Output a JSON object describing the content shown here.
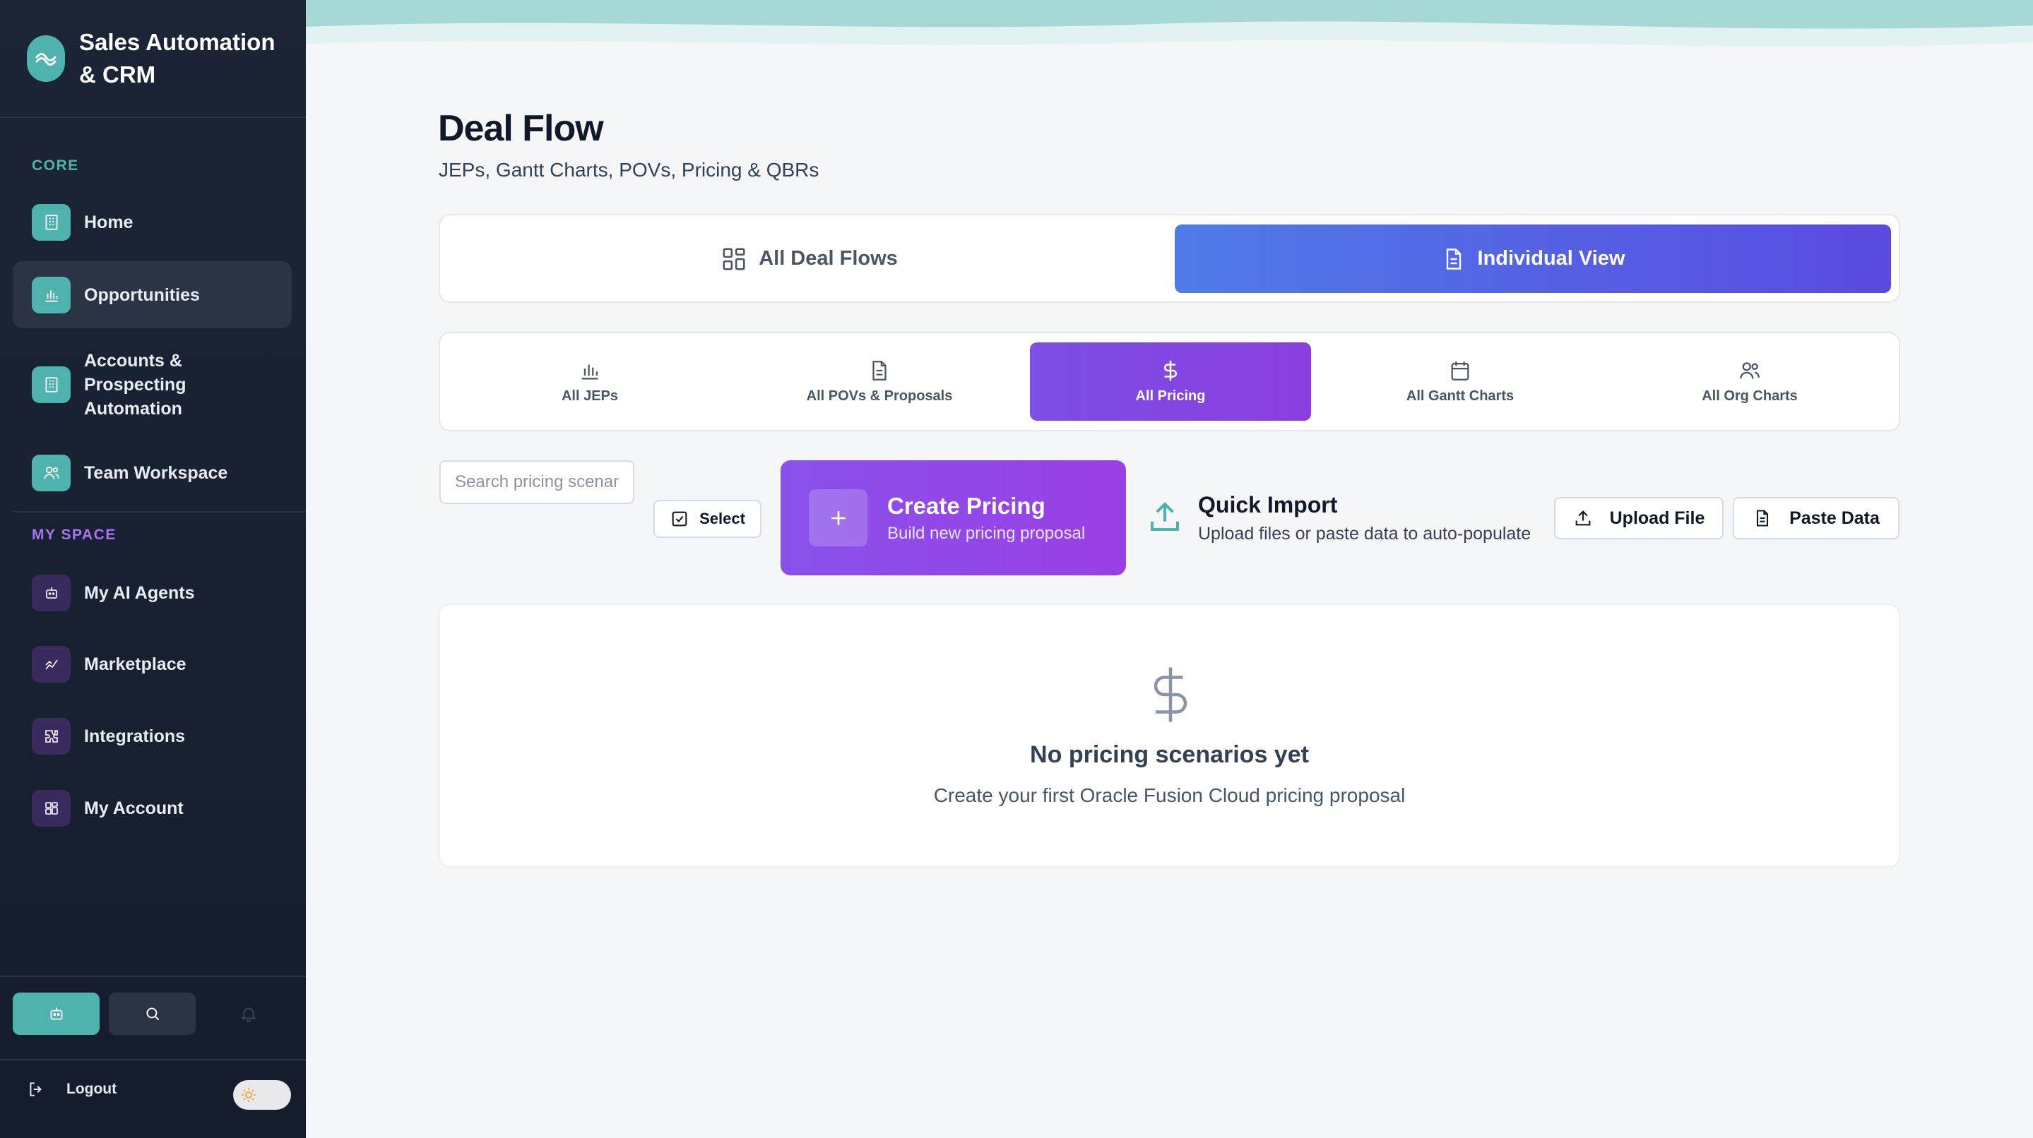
{
  "app": {
    "title": "Sales Automation & CRM",
    "accent": "#4fb3ad",
    "sidebar_bg": "#1b2535"
  },
  "sidebar": {
    "core_label": "CORE",
    "core_items": [
      {
        "label": "Home",
        "icon": "building-icon"
      },
      {
        "label": "Opportunities",
        "icon": "bar-chart-icon",
        "active": true
      },
      {
        "label": "Accounts & Prospecting Automation",
        "icon": "building-icon"
      },
      {
        "label": "Team Workspace",
        "icon": "users-icon"
      }
    ],
    "myspace_label": "MY SPACE",
    "myspace_items": [
      {
        "label": "My AI Agents",
        "icon": "bot-icon"
      },
      {
        "label": "Marketplace",
        "icon": "trending-icon"
      },
      {
        "label": "Integrations",
        "icon": "puzzle-icon"
      },
      {
        "label": "My Account",
        "icon": "grid-icon"
      }
    ],
    "logout_label": "Logout"
  },
  "header": {
    "title": "Deal Flow",
    "subtitle": "JEPs, Gantt Charts, POVs, Pricing & QBRs"
  },
  "view_switch": {
    "all_label": "All Deal Flows",
    "individual_label": "Individual View",
    "active": "Individual View"
  },
  "category_tabs": [
    {
      "label": "All JEPs",
      "icon": "bar-chart-icon"
    },
    {
      "label": "All POVs & Proposals",
      "icon": "document-icon"
    },
    {
      "label": "All Pricing",
      "icon": "dollar-icon",
      "active": true
    },
    {
      "label": "All Gantt Charts",
      "icon": "calendar-icon"
    },
    {
      "label": "All Org Charts",
      "icon": "users-icon"
    }
  ],
  "toolbar": {
    "search_placeholder": "Search pricing scenarios...",
    "select_label": "Select",
    "create_title": "Create Pricing",
    "create_subtitle": "Build new pricing proposal",
    "quick_import_title": "Quick Import",
    "quick_import_subtitle": "Upload files or paste data to auto-populate",
    "upload_label": "Upload File",
    "paste_label": "Paste Data"
  },
  "empty_state": {
    "title": "No pricing scenarios yet",
    "subtitle": "Create your first Oracle Fusion Cloud pricing proposal"
  }
}
